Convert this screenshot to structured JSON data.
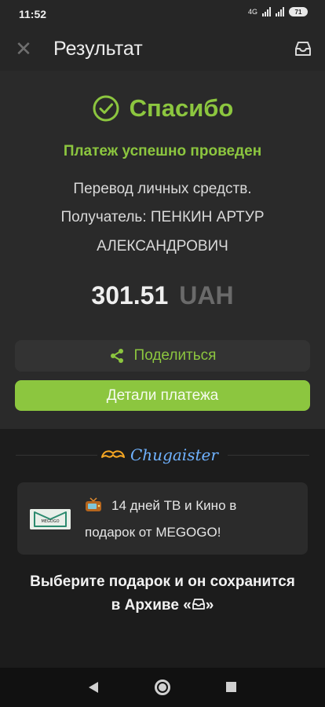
{
  "status_bar": {
    "time": "11:52",
    "network": "4G",
    "battery": "71"
  },
  "app_bar": {
    "title": "Результат",
    "close_icon": "close-icon",
    "archive_icon": "archive-tray-icon"
  },
  "result": {
    "heading": "Спасибо",
    "success": "Платеж успешно проведен",
    "description": "Перевод личных средств.",
    "recipient_line1": "Получатель: ПЕНКИН АРТУР",
    "recipient_line2": "АЛЕКСАНДРОВИЧ",
    "amount": "301.51",
    "currency": "UAH",
    "share_label": "Поделиться",
    "details_label": "Детали платежа"
  },
  "promo": {
    "brand": "Chugaister",
    "logo_name": "MEGOGO",
    "line1": "14 дней ТВ и Кино в",
    "line2": "подарок от MEGOGO!",
    "footer_line1": "Выберите подарок и он сохранится",
    "footer_line2_prefix": "в Архиве «",
    "footer_line2_suffix": "»"
  },
  "colors": {
    "accent": "#8cc63f",
    "background": "#1b1b1b",
    "card": "#2a2a2a",
    "brand": "#6fb2ff"
  }
}
